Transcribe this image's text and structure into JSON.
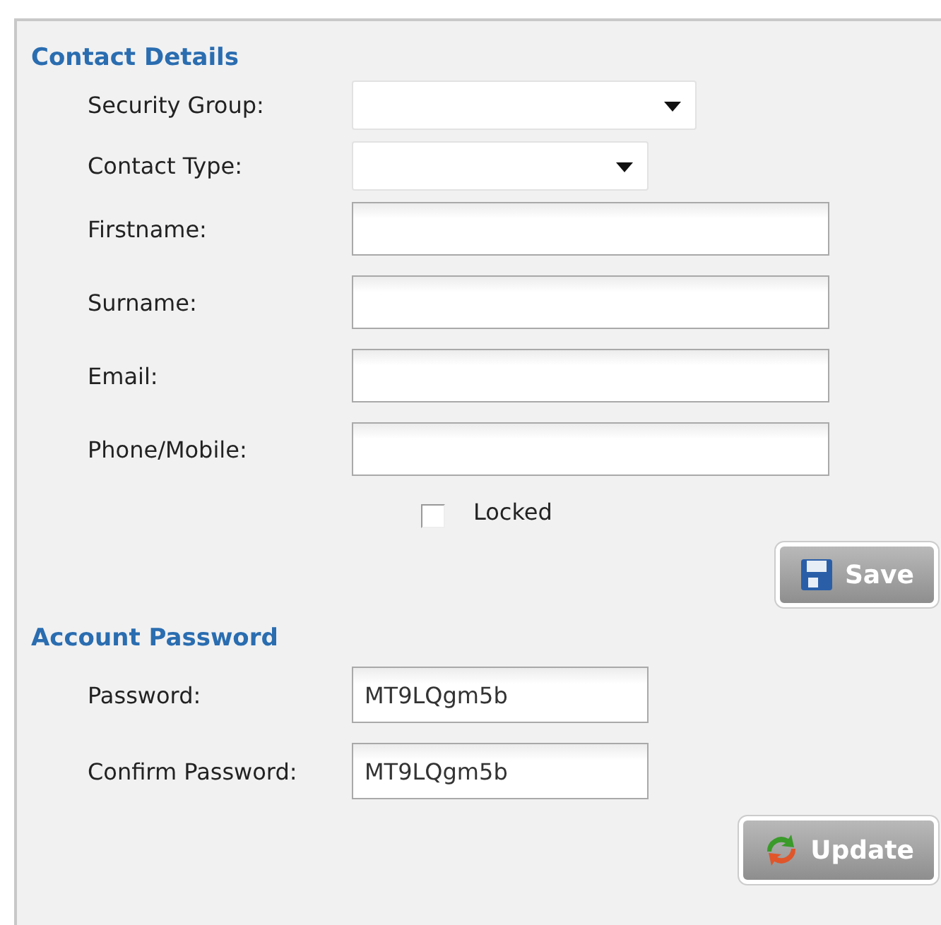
{
  "sections": [
    {
      "title": "Contact Details",
      "fields": [
        {
          "kind": "dropdown",
          "label": "Security Group:"
        },
        {
          "kind": "dropdown",
          "label": "Contact Type:"
        },
        {
          "kind": "text",
          "label": "Firstname:"
        },
        {
          "kind": "text",
          "label": "Surname:"
        },
        {
          "kind": "text",
          "label": "Email:"
        },
        {
          "kind": "text",
          "label": "Phone/Mobile:"
        }
      ],
      "checkbox": {
        "label": "Locked",
        "checked": false
      },
      "button": {
        "label": "Save",
        "kind": "save"
      }
    },
    {
      "title": "Account Password",
      "fields": [
        {
          "kind": "password",
          "label": "Password:",
          "value": "MT9LQgm5b"
        },
        {
          "kind": "password",
          "label": "Confirm Password:",
          "value": "MT9LQgm5b"
        }
      ],
      "button": {
        "label": "Update",
        "kind": "update"
      }
    }
  ]
}
